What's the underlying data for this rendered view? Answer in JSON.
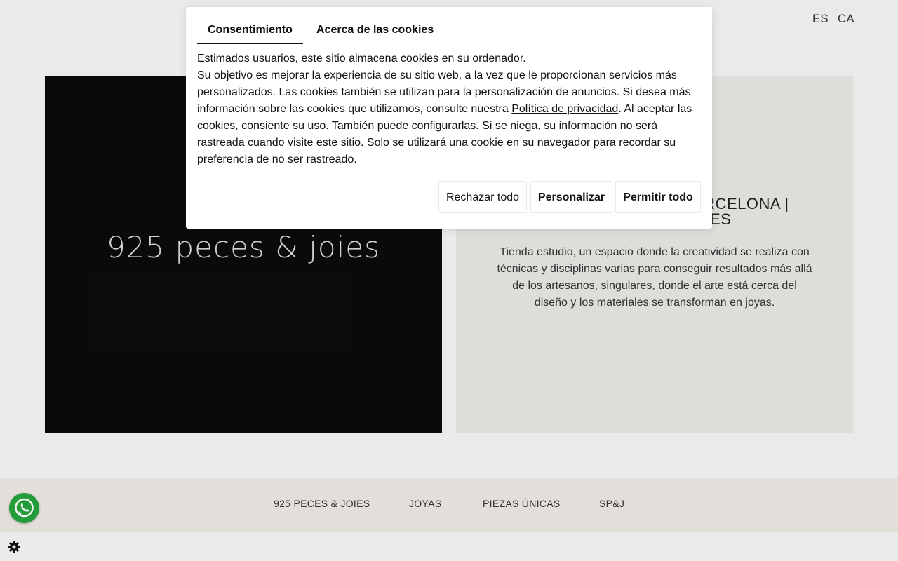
{
  "header": {
    "languages": [
      "ES",
      "CA"
    ]
  },
  "hero": {
    "logo_text": "925 peces & joies",
    "heading_line1": "ARCELONA |",
    "heading_line2": "ES",
    "description": "Tienda estudio, un espacio donde la creatividad se realiza con técnicas y disciplinas varias para conseguir resultados más allá de los artesanos, singulares, donde el arte está cerca del diseño y los materiales se transforman en joyas."
  },
  "footer_nav": {
    "items": [
      "925 PECES & JOIES",
      "JOYAS",
      "PIEZAS ÚNICAS",
      "SP&J"
    ]
  },
  "cookie_modal": {
    "tabs": [
      "Consentimiento",
      "Acerca de las cookies"
    ],
    "text_line1": "Estimados usuarios, este sitio almacena cookies en su ordenador.",
    "text_part1": "Su objetivo es mejorar la experiencia de su sitio web, a la vez que le proporcionan servicios más personalizados. Las cookies también se utilizan para la personalización de anuncios. Si desea más información sobre las cookies que utilizamos, consulte nuestra ",
    "privacy_link": "Política de privacidad",
    "text_part2": ". Al aceptar las cookies, consiente su uso. También puede configurarlas. Si se niega, su información no será rastreada cuando visite este sitio. Solo se utilizará una cookie en su navegador para recordar su preferencia de no ser rastreado.",
    "buttons": {
      "reject": "Rechazar todo",
      "customize": "Personalizar",
      "allow": "Permitir todo"
    }
  },
  "icons": {
    "whatsapp": "whatsapp-icon",
    "settings": "gear-icon"
  },
  "colors": {
    "whatsapp_green": "#25a33d",
    "hero_dark": "#0b0b0b",
    "hero_light": "#e8e6e3",
    "footer_bg": "#ece8e2"
  }
}
